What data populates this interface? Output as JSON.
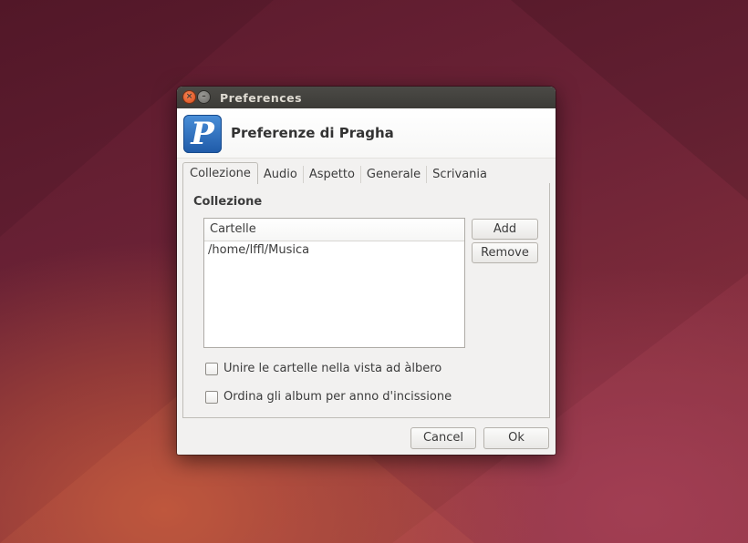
{
  "window": {
    "title": "Preferences"
  },
  "header": {
    "title": "Preferenze di Pragha",
    "app_icon": "pragha-logo-icon"
  },
  "tabs": [
    {
      "label": "Collezione",
      "active": true
    },
    {
      "label": "Audio",
      "active": false
    },
    {
      "label": "Aspetto",
      "active": false
    },
    {
      "label": "Generale",
      "active": false
    },
    {
      "label": "Scrivania",
      "active": false
    }
  ],
  "collection": {
    "section_title": "Collezione",
    "folders_column": "Cartelle",
    "folders": [
      "/home/lffl/Musica"
    ],
    "add_label": "Add",
    "remove_label": "Remove"
  },
  "options": [
    {
      "label": "Unire le cartelle nella vista ad àlbero",
      "checked": false
    },
    {
      "label": "Ordina gli album per anno d'incissione",
      "checked": false
    }
  ],
  "footer": {
    "cancel_label": "Cancel",
    "ok_label": "Ok"
  },
  "colors": {
    "accent_orange": "#d94f1e",
    "titlebar": "#3c3b37",
    "dialog_bg": "#f2f1f0"
  }
}
